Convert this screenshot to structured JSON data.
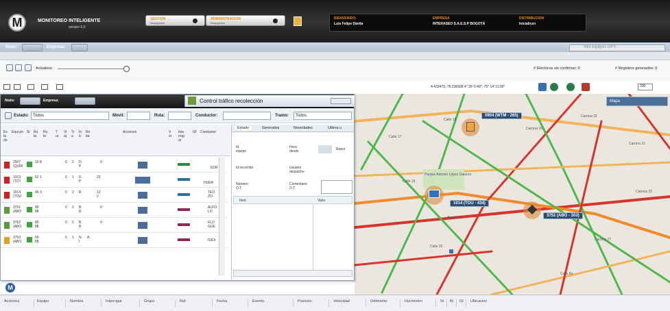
{
  "app": {
    "title": "MONITOREO INTELIGENTE",
    "version": "version 5.0"
  },
  "toggles": [
    {
      "label": "GESTION",
      "sub": "Descripcion"
    },
    {
      "label": "ADMINISTRACION",
      "sub": "Descripcion"
    }
  ],
  "header": {
    "welcome_label": "BIENVENIDO,",
    "user": "Luis Felipe Dávila",
    "company_label": "EMPRESA",
    "company": "INTERASEO S.A.E.S.P BOGOTÁ",
    "distribution_label": "DISTRIBUCION",
    "distribution": "Inicialicen"
  },
  "filters": {
    "node_label": "Nodo:",
    "company_label": "Empresa:",
    "my_gps": "Mis equipos GPS"
  },
  "toolbar": {
    "update_label": "Actualizar",
    "unconfirmed": "# Eléctricos sin confirmar: 0",
    "generated": "# Registros generados: 0"
  },
  "map_toolbar": {
    "coords": "4.433479,-75.236928 4° 26' 0.40\",-75° 14' 11.00\"",
    "zoom": "200",
    "map_type": "Mapa"
  },
  "window": {
    "title": "Control tráfico recolección",
    "node_label": "Nodo:",
    "company_label": "Empresa:",
    "state_label": "Estado:",
    "state_value": "Todos",
    "mobile_label": "Móvil:",
    "route_label": "Ruta:",
    "driver_label": "Conductor:",
    "stretch_label": "Tramo:",
    "stretch_value": "Todos",
    "columns": [
      "Es ta do",
      "Equi po",
      "Sl",
      "Ru ta",
      "Ru te",
      "T ur",
      "Vi aj",
      "Tr a",
      "In ic",
      "Re ba",
      "Acciones",
      "V el",
      "Inte rrog ar",
      "Gf",
      "Conductor"
    ],
    "rows": [
      {
        "equipo": "2507 (QUIR",
        "ruta": "10 8",
        "t": "0",
        "v": "2",
        "tr": "D. P",
        "re": "0",
        "driver": "EDR"
      },
      {
        "equipo": "1013 (TOT",
        "ruta": "52 1",
        "t": "0",
        "v": "1",
        "tr": "D. P",
        "re": "23",
        "driver": "HUER"
      },
      {
        "equipo": "1014 (TOU",
        "ruta": "46 3",
        "t": "0",
        "v": "2",
        "tr": "R.",
        "re": "12 2",
        "driver": "TEO ZO"
      },
      {
        "equipo": "3751 (ABO",
        "ruta": "89 88",
        "t": "0",
        "v": "2",
        "tr": "B. R",
        "re": "0",
        "driver": "ALFO LO"
      },
      {
        "equipo": "3752 (ABO",
        "ruta": "89 88",
        "t": "0",
        "v": "2",
        "tr": "B. R",
        "re": "0",
        "driver": "FLO GUE"
      },
      {
        "equipo": "3753 (ABO",
        "ruta": "59 88",
        "t": "0",
        "v": "1",
        "tr": "N. I",
        "re": "A.",
        "driver": "ISIDI"
      }
    ],
    "tabs": [
      "Estado",
      "Generales",
      "Novedades",
      "Ultima u"
    ],
    "detail": {
      "id_equipo": "Id equipo",
      "hora_desde": "Hora desde",
      "reportar": "Repor",
      "id_recorrido": "Id recorrido",
      "usuario": "Usuario despacho",
      "numero_ot": "Número O.T.",
      "comentario": "Comentario O.T.",
      "item": "Item",
      "valor": "Valor"
    }
  },
  "map_labels": [
    "0904 (WTM - 265)",
    "1014 (TOU - 434)",
    "3751 (ABO - 303)"
  ],
  "streets": [
    "Carrera 16",
    "Calle 18",
    "Calle 19",
    "Carrera 21",
    "Carrera 22",
    "Calle 17",
    "Avenida 9",
    "Parque Antonio López Galarza",
    "Calle 20",
    "Carrera 27",
    "Carrera 22",
    "Calle 8a"
  ],
  "status_columns": [
    "Acciones",
    "Equipo",
    "Nombre",
    "Interrogar",
    "Grupo",
    "Ref.",
    "Fecha",
    "Evento",
    "Posición",
    "Velocidad",
    "Odómetro",
    "Horómetro",
    "St",
    "Bt",
    "Gf",
    "Ubicacion"
  ]
}
